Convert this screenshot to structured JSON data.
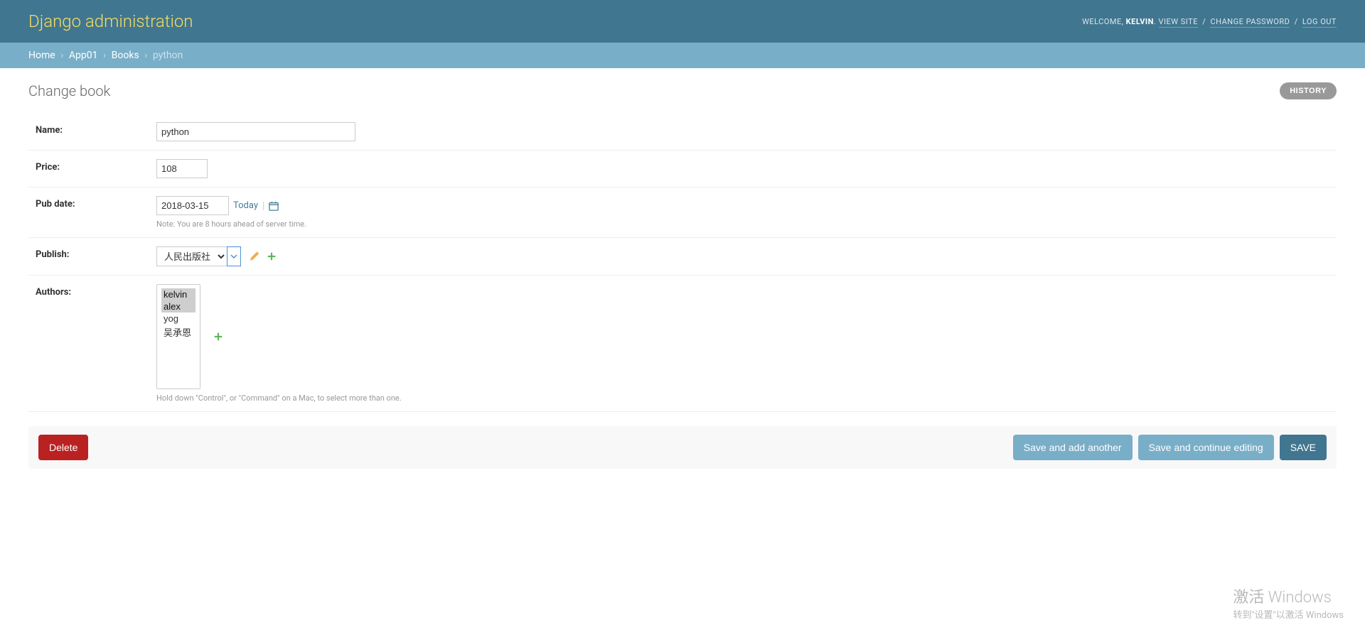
{
  "header": {
    "site_title": "Django administration",
    "welcome": "WELCOME,",
    "username": "KELVIN",
    "view_site": "VIEW SITE",
    "change_password": "CHANGE PASSWORD",
    "log_out": "LOG OUT"
  },
  "breadcrumbs": {
    "home": "Home",
    "app": "App01",
    "model": "Books",
    "object": "python"
  },
  "page": {
    "title": "Change book",
    "history": "HISTORY"
  },
  "form": {
    "name": {
      "label": "Name:",
      "value": "python"
    },
    "price": {
      "label": "Price:",
      "value": "108"
    },
    "pub_date": {
      "label": "Pub date:",
      "value": "2018-03-15",
      "today": "Today",
      "note": "Note: You are 8 hours ahead of server time."
    },
    "publish": {
      "label": "Publish:",
      "value": "人民出版社",
      "options": [
        "人民出版社"
      ]
    },
    "authors": {
      "label": "Authors:",
      "options": [
        "kelvin",
        "alex",
        "yog",
        "吴承恩"
      ],
      "selected": [
        "kelvin",
        "alex"
      ],
      "help": "Hold down \"Control\", or \"Command\" on a Mac, to select more than one."
    }
  },
  "buttons": {
    "delete": "Delete",
    "save_add": "Save and add another",
    "save_continue": "Save and continue editing",
    "save": "SAVE"
  },
  "watermark": {
    "line1": "激活 Windows",
    "line2": "转到\"设置\"以激活 Windows"
  }
}
